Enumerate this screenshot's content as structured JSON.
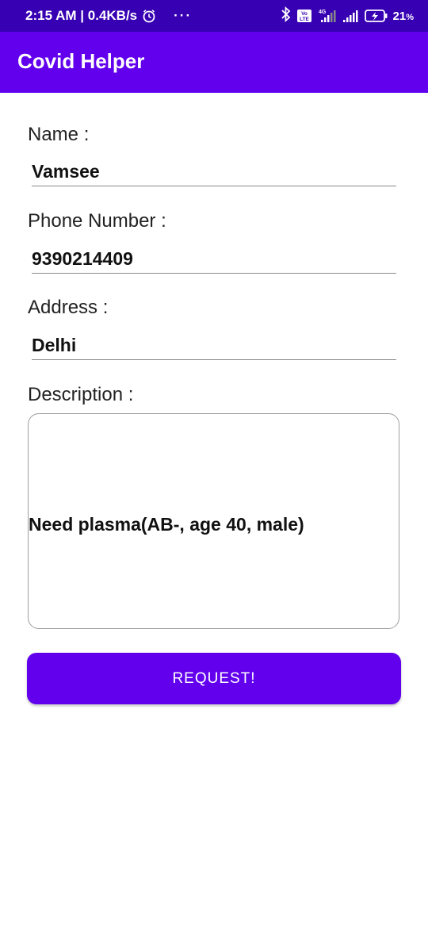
{
  "status_bar": {
    "time": "2:15 AM",
    "speed": "0.4KB/s",
    "more": "···",
    "battery_percent": "21",
    "battery_unit": "%",
    "network": "4G",
    "volte": "Vo LTE"
  },
  "app_bar": {
    "title": "Covid Helper"
  },
  "form": {
    "name_label": "Name :",
    "name_value": "Vamsee",
    "phone_label": "Phone Number :",
    "phone_value": "9390214409",
    "address_label": "Address :",
    "address_value": "Delhi",
    "description_label": "Description :",
    "description_value": "Need plasma(AB-, age 40, male)",
    "submit_label": "REQUEST!"
  },
  "colors": {
    "status_bar": "#3700b3",
    "primary": "#6200ee"
  }
}
